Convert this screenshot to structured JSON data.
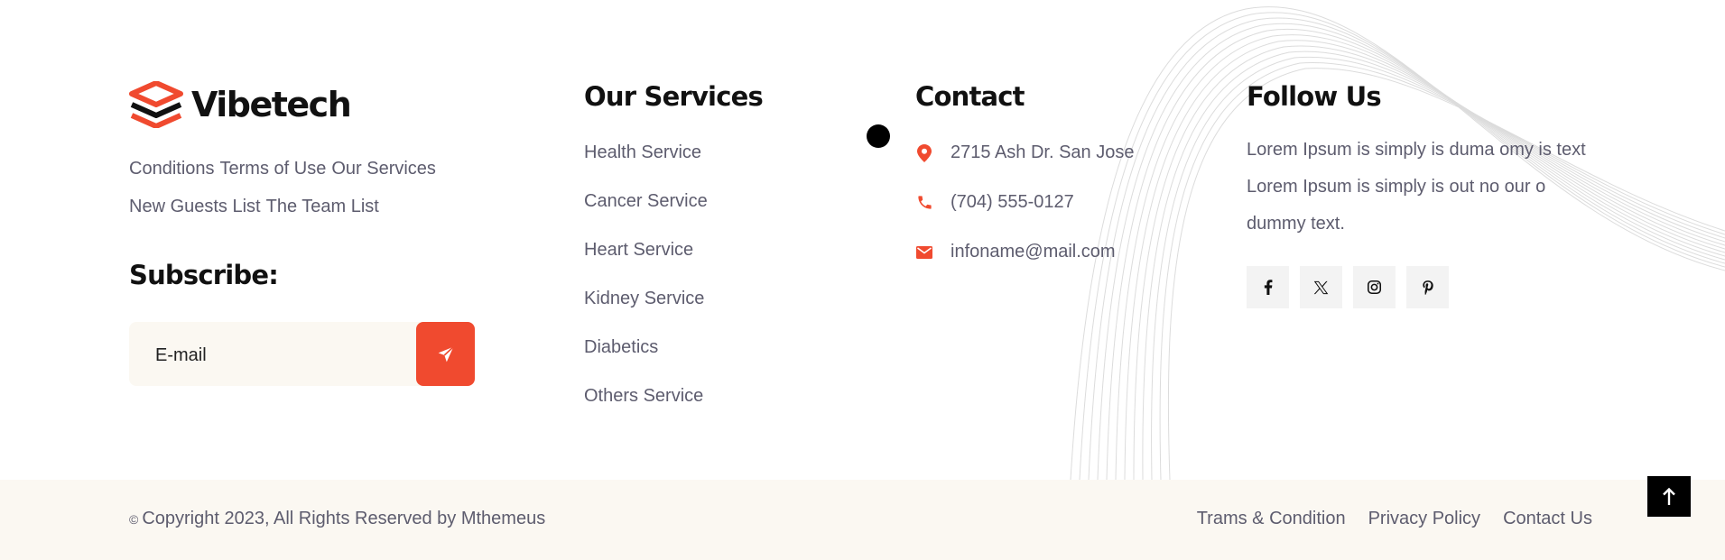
{
  "brand": {
    "name": "Vibetech",
    "accent_color": "#f04a2f"
  },
  "quick_links": [
    "Conditions",
    "Terms of Use",
    "Our Services",
    "New Guests List",
    "The Team List"
  ],
  "subscribe": {
    "title": "Subscribe:",
    "placeholder": "E-mail",
    "button_icon": "paper-plane-icon"
  },
  "services": {
    "title": "Our Services",
    "items": [
      "Health Service",
      "Cancer Service",
      "Heart Service",
      "Kidney Service",
      "Diabetics",
      "Others Service"
    ]
  },
  "contact": {
    "title": "Contact",
    "address": "2715 Ash Dr. San Jose",
    "phone": "(704) 555-0127",
    "email": "infoname@mail.com"
  },
  "follow": {
    "title": "Follow Us",
    "text": "Lorem Ipsum is simply is duma omy is text Lorem Ipsum is simply is out no our o dummy text.",
    "socials": [
      "facebook-icon",
      "x-icon",
      "instagram-icon",
      "pinterest-icon"
    ]
  },
  "footer": {
    "copyright_symbol": "©",
    "copyright": "Copyright 2023, All Rights Reserved by Mthemeus",
    "links": [
      "Trams & Condition",
      "Privacy Policy",
      "Contact Us"
    ]
  }
}
